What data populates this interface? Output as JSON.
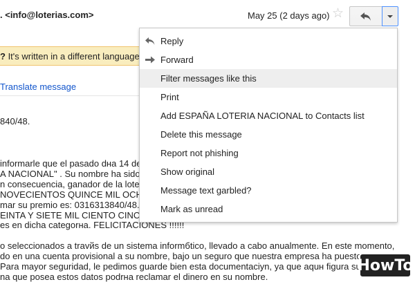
{
  "header": {
    "sender": ". <info@loterias.com>",
    "date": "May 25 (2 days ago)",
    "star_icon": "star-icon",
    "reply_icon": "reply-arrow-icon",
    "more_icon": "chevron-down-icon"
  },
  "language_bar": {
    "prefix": "?",
    "text": " It's written in a different language"
  },
  "translate": {
    "link": "Translate message"
  },
  "body_lines": [
    "840/48.",
    "informarle que el pasado dнa 14  de",
    "A NACIONAL\"  . Su nombre ha sido",
    "n consecuencia, ganador de la loter",
    "NOVECIENTOS QUINCE MIL OCH",
    "mar su premio es: 0316313840/48.",
    "EINTA Y SIETE MIL CIENTO CINC",
    "es en dicha categorнa. FELICITACIONES !!!!!!",
    "o seleccionados a travйs de un sistema informбtico, llevado a cabo anualmente. En este momento,",
    "do en una cuenta provisional a su nombre, bajo un seguro que nuestra empresa ha puesto a su",
    "Para mayor seguridad, le pedimos guarde bien esta documentaciуn, ya que aquн figura su numero",
    "na que posea estos datos podrнa reclamar el dinero en su nombre."
  ],
  "menu": {
    "items": [
      {
        "label": "Reply",
        "icon": "reply-icon"
      },
      {
        "label": "Forward",
        "icon": "forward-icon"
      },
      {
        "label": "Filter messages like this",
        "icon": ""
      },
      {
        "label": "Print",
        "icon": ""
      },
      {
        "label": "Add ESPAÑA LOTERIA NACIONAL to Contacts list",
        "icon": ""
      },
      {
        "label": "Delete this message",
        "icon": ""
      },
      {
        "label": "Report not phishing",
        "icon": ""
      },
      {
        "label": "Show original",
        "icon": ""
      },
      {
        "label": "Message text garbled?",
        "icon": ""
      },
      {
        "label": "Mark as unread",
        "icon": ""
      }
    ]
  },
  "watermark": {
    "text": "HowTo"
  },
  "colors": {
    "link": "#1155cc",
    "lang_bar_bg": "#f9edbe",
    "menu_hover": "#eeeeee",
    "focus_border": "#4d90fe"
  }
}
